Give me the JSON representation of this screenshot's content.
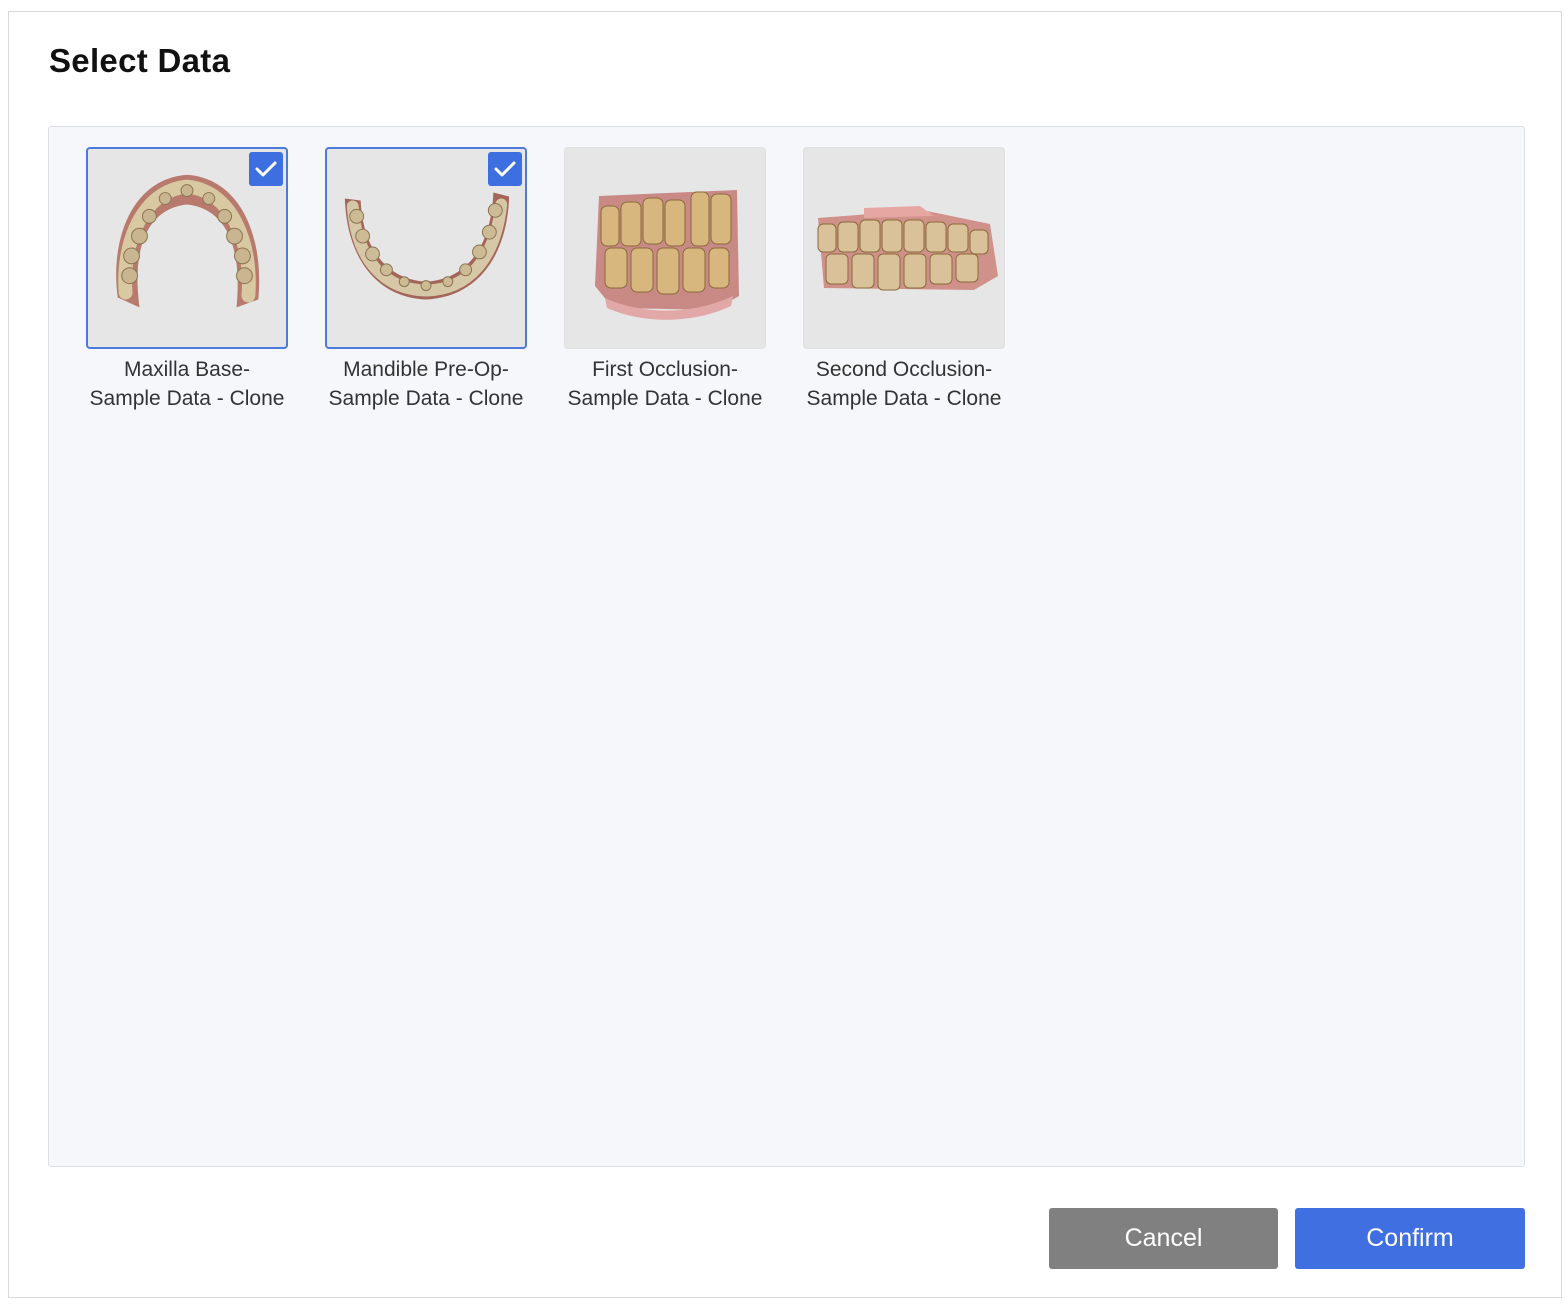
{
  "dialog": {
    "title": "Select Data",
    "items": [
      {
        "line1": "Maxilla Base-",
        "line2": "Sample Data - Clone",
        "selected": true,
        "thumbnail_icon": "maxilla-arch-icon"
      },
      {
        "line1": "Mandible Pre-Op-",
        "line2": "Sample Data - Clone",
        "selected": true,
        "thumbnail_icon": "mandible-arch-icon"
      },
      {
        "line1": "First Occlusion-",
        "line2": "Sample Data - Clone",
        "selected": false,
        "thumbnail_icon": "occlusion-icon"
      },
      {
        "line1": "Second Occlusion-",
        "line2": "Sample Data - Clone",
        "selected": false,
        "thumbnail_icon": "occlusion-icon"
      }
    ],
    "buttons": {
      "cancel_label": "Cancel",
      "confirm_label": "Confirm"
    }
  },
  "colors": {
    "accent": "#3f6fe0",
    "cancel": "#808080",
    "panel_bg": "#f5f7fa"
  }
}
